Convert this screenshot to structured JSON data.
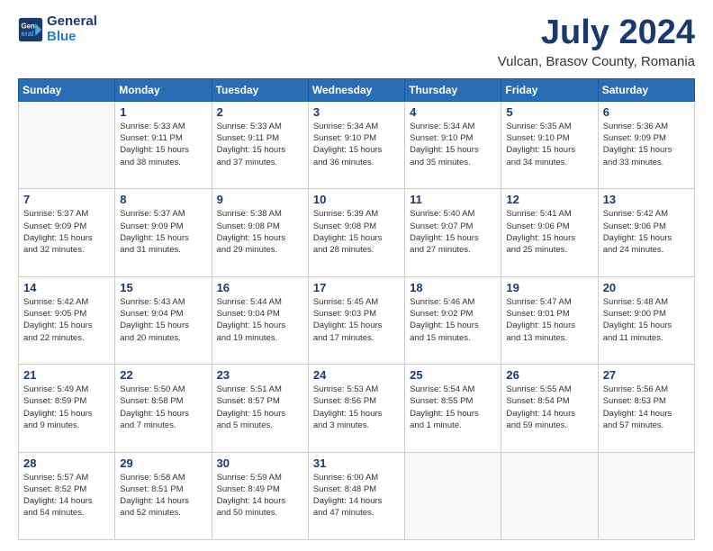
{
  "header": {
    "logo_general": "General",
    "logo_blue": "Blue",
    "month": "July 2024",
    "location": "Vulcan, Brasov County, Romania"
  },
  "weekdays": [
    "Sunday",
    "Monday",
    "Tuesday",
    "Wednesday",
    "Thursday",
    "Friday",
    "Saturday"
  ],
  "weeks": [
    [
      {
        "day": "",
        "sunrise": "",
        "sunset": "",
        "daylight": ""
      },
      {
        "day": "1",
        "sunrise": "Sunrise: 5:33 AM",
        "sunset": "Sunset: 9:11 PM",
        "daylight": "Daylight: 15 hours and 38 minutes."
      },
      {
        "day": "2",
        "sunrise": "Sunrise: 5:33 AM",
        "sunset": "Sunset: 9:11 PM",
        "daylight": "Daylight: 15 hours and 37 minutes."
      },
      {
        "day": "3",
        "sunrise": "Sunrise: 5:34 AM",
        "sunset": "Sunset: 9:10 PM",
        "daylight": "Daylight: 15 hours and 36 minutes."
      },
      {
        "day": "4",
        "sunrise": "Sunrise: 5:34 AM",
        "sunset": "Sunset: 9:10 PM",
        "daylight": "Daylight: 15 hours and 35 minutes."
      },
      {
        "day": "5",
        "sunrise": "Sunrise: 5:35 AM",
        "sunset": "Sunset: 9:10 PM",
        "daylight": "Daylight: 15 hours and 34 minutes."
      },
      {
        "day": "6",
        "sunrise": "Sunrise: 5:36 AM",
        "sunset": "Sunset: 9:09 PM",
        "daylight": "Daylight: 15 hours and 33 minutes."
      }
    ],
    [
      {
        "day": "7",
        "sunrise": "Sunrise: 5:37 AM",
        "sunset": "Sunset: 9:09 PM",
        "daylight": "Daylight: 15 hours and 32 minutes."
      },
      {
        "day": "8",
        "sunrise": "Sunrise: 5:37 AM",
        "sunset": "Sunset: 9:09 PM",
        "daylight": "Daylight: 15 hours and 31 minutes."
      },
      {
        "day": "9",
        "sunrise": "Sunrise: 5:38 AM",
        "sunset": "Sunset: 9:08 PM",
        "daylight": "Daylight: 15 hours and 29 minutes."
      },
      {
        "day": "10",
        "sunrise": "Sunrise: 5:39 AM",
        "sunset": "Sunset: 9:08 PM",
        "daylight": "Daylight: 15 hours and 28 minutes."
      },
      {
        "day": "11",
        "sunrise": "Sunrise: 5:40 AM",
        "sunset": "Sunset: 9:07 PM",
        "daylight": "Daylight: 15 hours and 27 minutes."
      },
      {
        "day": "12",
        "sunrise": "Sunrise: 5:41 AM",
        "sunset": "Sunset: 9:06 PM",
        "daylight": "Daylight: 15 hours and 25 minutes."
      },
      {
        "day": "13",
        "sunrise": "Sunrise: 5:42 AM",
        "sunset": "Sunset: 9:06 PM",
        "daylight": "Daylight: 15 hours and 24 minutes."
      }
    ],
    [
      {
        "day": "14",
        "sunrise": "Sunrise: 5:42 AM",
        "sunset": "Sunset: 9:05 PM",
        "daylight": "Daylight: 15 hours and 22 minutes."
      },
      {
        "day": "15",
        "sunrise": "Sunrise: 5:43 AM",
        "sunset": "Sunset: 9:04 PM",
        "daylight": "Daylight: 15 hours and 20 minutes."
      },
      {
        "day": "16",
        "sunrise": "Sunrise: 5:44 AM",
        "sunset": "Sunset: 9:04 PM",
        "daylight": "Daylight: 15 hours and 19 minutes."
      },
      {
        "day": "17",
        "sunrise": "Sunrise: 5:45 AM",
        "sunset": "Sunset: 9:03 PM",
        "daylight": "Daylight: 15 hours and 17 minutes."
      },
      {
        "day": "18",
        "sunrise": "Sunrise: 5:46 AM",
        "sunset": "Sunset: 9:02 PM",
        "daylight": "Daylight: 15 hours and 15 minutes."
      },
      {
        "day": "19",
        "sunrise": "Sunrise: 5:47 AM",
        "sunset": "Sunset: 9:01 PM",
        "daylight": "Daylight: 15 hours and 13 minutes."
      },
      {
        "day": "20",
        "sunrise": "Sunrise: 5:48 AM",
        "sunset": "Sunset: 9:00 PM",
        "daylight": "Daylight: 15 hours and 11 minutes."
      }
    ],
    [
      {
        "day": "21",
        "sunrise": "Sunrise: 5:49 AM",
        "sunset": "Sunset: 8:59 PM",
        "daylight": "Daylight: 15 hours and 9 minutes."
      },
      {
        "day": "22",
        "sunrise": "Sunrise: 5:50 AM",
        "sunset": "Sunset: 8:58 PM",
        "daylight": "Daylight: 15 hours and 7 minutes."
      },
      {
        "day": "23",
        "sunrise": "Sunrise: 5:51 AM",
        "sunset": "Sunset: 8:57 PM",
        "daylight": "Daylight: 15 hours and 5 minutes."
      },
      {
        "day": "24",
        "sunrise": "Sunrise: 5:53 AM",
        "sunset": "Sunset: 8:56 PM",
        "daylight": "Daylight: 15 hours and 3 minutes."
      },
      {
        "day": "25",
        "sunrise": "Sunrise: 5:54 AM",
        "sunset": "Sunset: 8:55 PM",
        "daylight": "Daylight: 15 hours and 1 minute."
      },
      {
        "day": "26",
        "sunrise": "Sunrise: 5:55 AM",
        "sunset": "Sunset: 8:54 PM",
        "daylight": "Daylight: 14 hours and 59 minutes."
      },
      {
        "day": "27",
        "sunrise": "Sunrise: 5:56 AM",
        "sunset": "Sunset: 8:53 PM",
        "daylight": "Daylight: 14 hours and 57 minutes."
      }
    ],
    [
      {
        "day": "28",
        "sunrise": "Sunrise: 5:57 AM",
        "sunset": "Sunset: 8:52 PM",
        "daylight": "Daylight: 14 hours and 54 minutes."
      },
      {
        "day": "29",
        "sunrise": "Sunrise: 5:58 AM",
        "sunset": "Sunset: 8:51 PM",
        "daylight": "Daylight: 14 hours and 52 minutes."
      },
      {
        "day": "30",
        "sunrise": "Sunrise: 5:59 AM",
        "sunset": "Sunset: 8:49 PM",
        "daylight": "Daylight: 14 hours and 50 minutes."
      },
      {
        "day": "31",
        "sunrise": "Sunrise: 6:00 AM",
        "sunset": "Sunset: 8:48 PM",
        "daylight": "Daylight: 14 hours and 47 minutes."
      },
      {
        "day": "",
        "sunrise": "",
        "sunset": "",
        "daylight": ""
      },
      {
        "day": "",
        "sunrise": "",
        "sunset": "",
        "daylight": ""
      },
      {
        "day": "",
        "sunrise": "",
        "sunset": "",
        "daylight": ""
      }
    ]
  ]
}
